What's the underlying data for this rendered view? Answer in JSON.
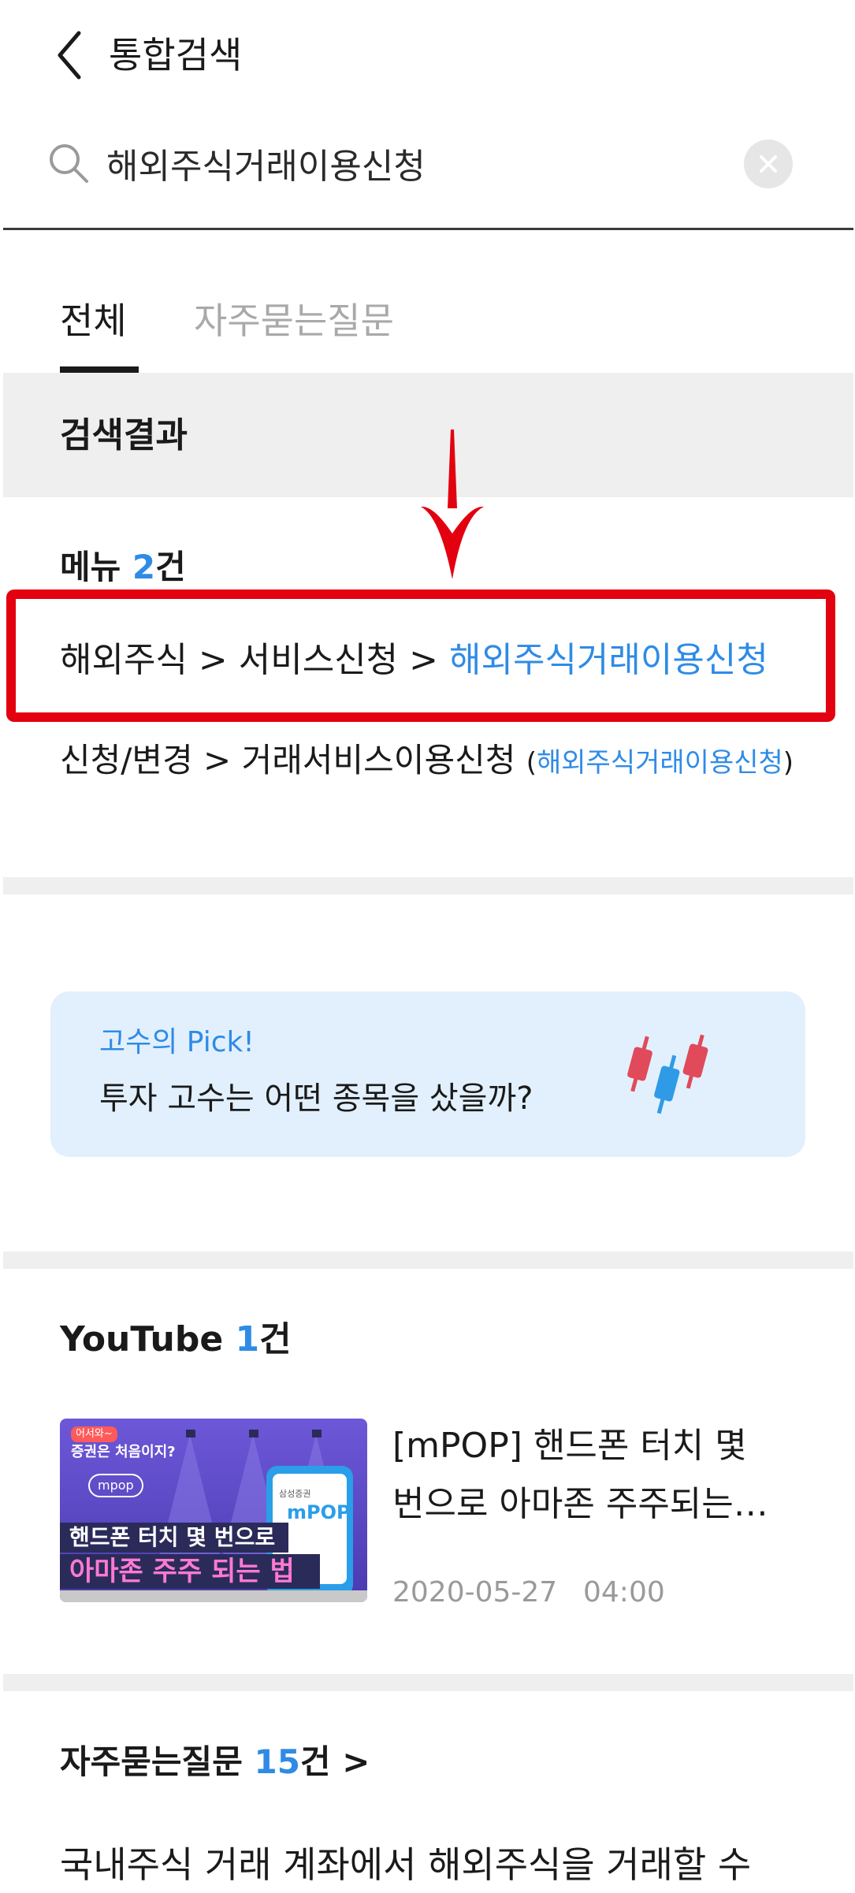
{
  "header": {
    "title": "통합검색"
  },
  "search": {
    "value": "해외주식거래이용신청"
  },
  "tabs": [
    {
      "label": "전체"
    },
    {
      "label": "자주묻는질문"
    }
  ],
  "results": {
    "title": "검색결과"
  },
  "menu": {
    "label": "메뉴",
    "count": "2",
    "unit": "건",
    "items": [
      {
        "path": "해외주식 > 서비스신청 > ",
        "highlight": "해외주식거래이용신청"
      },
      {
        "path": "신청/변경 > 거래서비스이용신청 ",
        "open": "(",
        "highlight": "해외주식거래이용신청",
        "close": ")"
      }
    ]
  },
  "pick": {
    "label": "고수의 Pick!",
    "title": "투자 고수는 어떤 종목을 샀을까?"
  },
  "youtube": {
    "label": "YouTube",
    "count": "1",
    "unit": "건",
    "video": {
      "title_line1": "[mPOP] 핸드폰 터치 몇",
      "title_line2": "번으로 아마존 주주되는…",
      "date": "2020-05-27",
      "time": "04:00",
      "thumb_text_small": "증권은 처음이지?",
      "thumb_badge": "어서와~",
      "thumb_bubble": "mpop",
      "thumb_line1": "핸드폰 터치 몇 번으로",
      "thumb_line2": "아마존 주주 되는 법",
      "thumb_phone_brand": "삼성증권",
      "thumb_phone_app": "mPOP"
    }
  },
  "faq": {
    "label": "자주묻는질문",
    "count": "15",
    "unit": "건",
    "chevron": ">",
    "first_item": "국내주식 거래 계좌에서 해외주식을 거래할 수"
  },
  "colors": {
    "accent": "#2f8be6",
    "highlight_red": "#e3000f",
    "card_bg": "#e2f0fd"
  }
}
